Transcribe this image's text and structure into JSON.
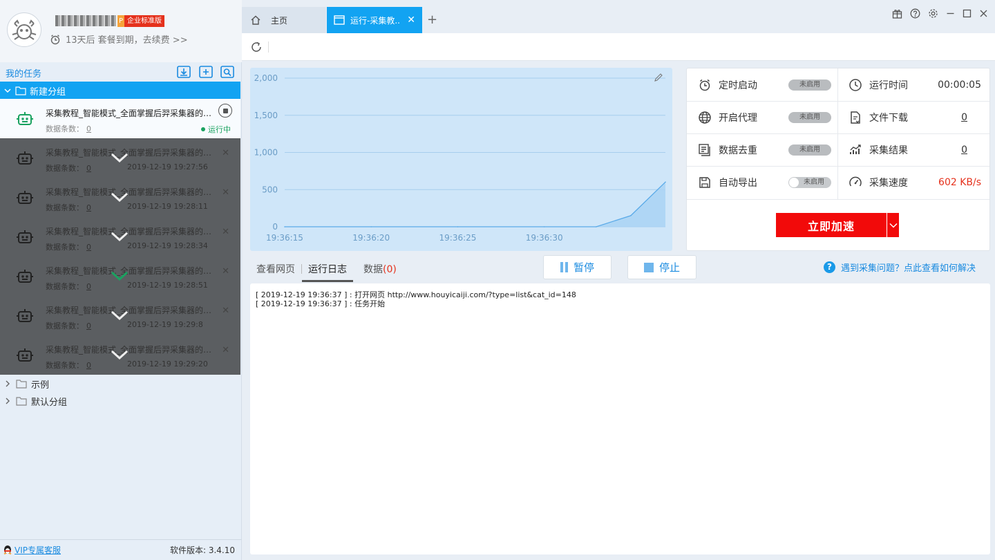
{
  "profile": {
    "p_badge": "P",
    "edition_badge": "企业标准版",
    "expire_text": "13天后 套餐到期，去续费 >>"
  },
  "sidebar": {
    "my_tasks_label": "我的任务",
    "active_group": "新建分组",
    "tasks": [
      {
        "name": "采集教程_智能模式_全面掌握后羿采集器的使用方法",
        "count_label": "数据条数：",
        "count": "0",
        "status": "运行中"
      },
      {
        "name": "采集教程_智能模式_全面掌握后羿采集器的使用方法",
        "count_label": "数据条数：",
        "count": "0",
        "time": "2019-12-19 19:27:56"
      },
      {
        "name": "采集教程_智能模式_全面掌握后羿采集器的使用方法",
        "count_label": "数据条数：",
        "count": "0",
        "time": "2019-12-19 19:28:11"
      },
      {
        "name": "采集教程_智能模式_全面掌握后羿采集器的使用方法",
        "count_label": "数据条数：",
        "count": "0",
        "time": "2019-12-19 19:28:34"
      },
      {
        "name": "采集教程_智能模式_全面掌握后羿采集器的使用方法",
        "count_label": "数据条数：",
        "count": "0",
        "time": "2019-12-19 19:28:51"
      },
      {
        "name": "采集教程_智能模式_全面掌握后羿采集器的使用方法",
        "count_label": "数据条数：",
        "count": "0",
        "time": "2019-12-19 19:29:8"
      },
      {
        "name": "采集教程_智能模式_全面掌握后羿采集器的使用方法",
        "count_label": "数据条数：",
        "count": "0",
        "time": "2019-12-19 19:29:20"
      }
    ],
    "other_groups": [
      "示例",
      "默认分组"
    ],
    "footer": {
      "vip_label": "VIP专属客服",
      "version_label": "软件版本: 3.4.10"
    }
  },
  "tabs": {
    "home_label": "主页",
    "run_label": "运行-采集教..",
    "close_glyph": "✕",
    "add_glyph": "+"
  },
  "chart_data": {
    "type": "area",
    "x": [
      "19:36:15",
      "19:36:20",
      "19:36:25",
      "19:36:30",
      "19:36:33",
      "19:36:35",
      "19:36:37"
    ],
    "values": [
      0,
      0,
      0,
      0,
      0,
      150,
      602
    ],
    "yticks": [
      "2,000",
      "1,500",
      "1,000",
      "500",
      "0"
    ],
    "xticks": [
      "19:36:15",
      "19:36:20",
      "19:36:25",
      "19:36:30"
    ],
    "ylim": [
      0,
      2000
    ],
    "grid": true,
    "color": "#5aaae8"
  },
  "stats": {
    "timer": {
      "label": "定时启动",
      "value": "未启用"
    },
    "runtime": {
      "label": "运行时间",
      "value": "00:00:05"
    },
    "proxy": {
      "label": "开启代理",
      "value": "未启用"
    },
    "download": {
      "label": "文件下载",
      "value": "0"
    },
    "dedup": {
      "label": "数据去重",
      "value": "未启用"
    },
    "result": {
      "label": "采集结果",
      "value": "0"
    },
    "export": {
      "label": "自动导出",
      "value": "未启用"
    },
    "speed": {
      "label": "采集速度",
      "value": "602 KB/s"
    },
    "accel_label": "立即加速"
  },
  "log_tabs": {
    "view_page": "查看网页",
    "run_log": "运行日志",
    "data_label": "数据",
    "data_count": "(0)"
  },
  "controls": {
    "pause_label": "暂停",
    "stop_label": "停止"
  },
  "help_label": "遇到采集问题？点此查看如何解决",
  "log_lines": [
    "[ 2019-12-19 19:36:37 ] : 打开网页 http://www.houyicaiji.com/?type=list&cat_id=148",
    "[ 2019-12-19 19:36:37 ] : 任务开始"
  ],
  "colors": {
    "accent": "#12a3f2",
    "danger": "#f20a0a",
    "running": "#1aa260"
  }
}
